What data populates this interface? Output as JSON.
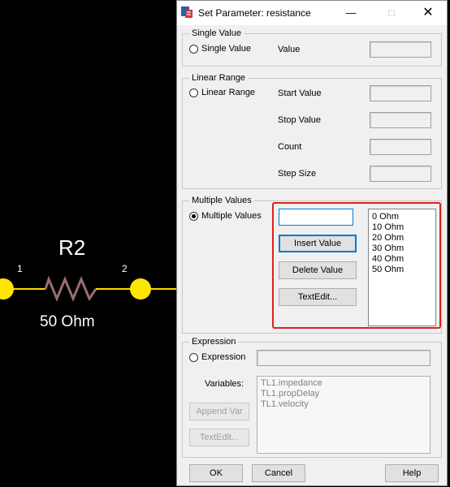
{
  "schematic": {
    "ref": "R2",
    "value": "50 Ohm",
    "pin1": "1",
    "pin2": "2"
  },
  "dialog": {
    "title": "Set Parameter: resistance",
    "single_value": {
      "group_title": "Single Value",
      "radio_label": "Single Value",
      "value_label": "Value"
    },
    "linear_range": {
      "group_title": "Linear Range",
      "radio_label": "Linear Range",
      "start_label": "Start Value",
      "stop_label": "Stop Value",
      "count_label": "Count",
      "step_label": "Step Size"
    },
    "multiple_values": {
      "group_title": "Multiple Values",
      "radio_label": "Multiple Values",
      "input_value": "",
      "insert_label": "Insert Value",
      "delete_label": "Delete Value",
      "textedit_label": "TextEdit...",
      "items": [
        "0 Ohm",
        "10 Ohm",
        "20 Ohm",
        "30 Ohm",
        "40 Ohm",
        "50 Ohm"
      ]
    },
    "expression": {
      "group_title": "Expression",
      "radio_label": "Expression",
      "variables_label": "Variables:",
      "append_label": "Append Var",
      "textedit_label": "TextEdit...",
      "variables": [
        "TL1.impedance",
        "TL1.propDelay",
        "TL1.velocity"
      ]
    },
    "ok_label": "OK",
    "cancel_label": "Cancel",
    "help_label": "Help"
  },
  "colors": {
    "highlight": "#e0201a",
    "wire": "#ffd700",
    "resistor": "#9a6e6e"
  },
  "icons": [
    "app-icon",
    "minimize-icon",
    "maximize-icon",
    "close-icon"
  ]
}
